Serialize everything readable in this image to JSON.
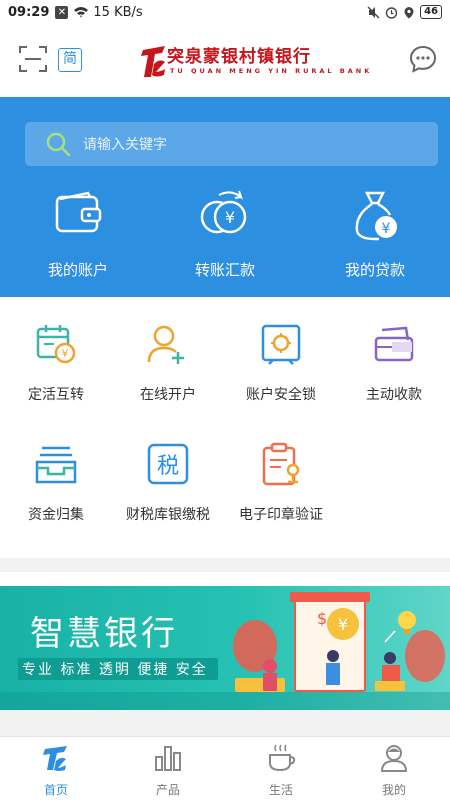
{
  "status_bar": {
    "time": "09:29",
    "speed": "15 KB/s",
    "battery": "46"
  },
  "header": {
    "lang_label": "简",
    "logo_title": "突泉蒙银村镇银行",
    "logo_subtitle": "TU QUAN MENG YIN RURAL BANK",
    "brand_color": "#c4161c"
  },
  "search": {
    "placeholder": "请输入关键字"
  },
  "hero_items": [
    {
      "label": "我的账户",
      "icon": "wallet-icon"
    },
    {
      "label": "转账汇款",
      "icon": "transfer-coins-icon"
    },
    {
      "label": "我的贷款",
      "icon": "money-bag-icon"
    }
  ],
  "grid_items": [
    {
      "label": "定活互转",
      "icon": "calendar-yuan-icon"
    },
    {
      "label": "在线开户",
      "icon": "add-user-icon"
    },
    {
      "label": "账户安全锁",
      "icon": "safe-icon"
    },
    {
      "label": "主动收款",
      "icon": "card-receive-icon"
    },
    {
      "label": "资金归集",
      "icon": "tray-collect-icon"
    },
    {
      "label": "财税库银缴税",
      "icon": "tax-icon"
    },
    {
      "label": "电子印章验证",
      "icon": "seal-verify-icon"
    }
  ],
  "promo": {
    "title": "智慧银行",
    "subtitle": "专业 标准 透明 便捷 安全"
  },
  "tabs": [
    {
      "label": "首页",
      "icon": "home-logo-icon",
      "active": true
    },
    {
      "label": "产品",
      "icon": "products-chart-icon",
      "active": false
    },
    {
      "label": "生活",
      "icon": "coffee-cup-icon",
      "active": false
    },
    {
      "label": "我的",
      "icon": "profile-icon",
      "active": false
    }
  ],
  "colors": {
    "primary": "#2d8fe0",
    "promo": "#27c2b3",
    "accent_orange": "#f2a12b",
    "accent_green": "#3db4a6",
    "accent_purple": "#8a63c8"
  }
}
